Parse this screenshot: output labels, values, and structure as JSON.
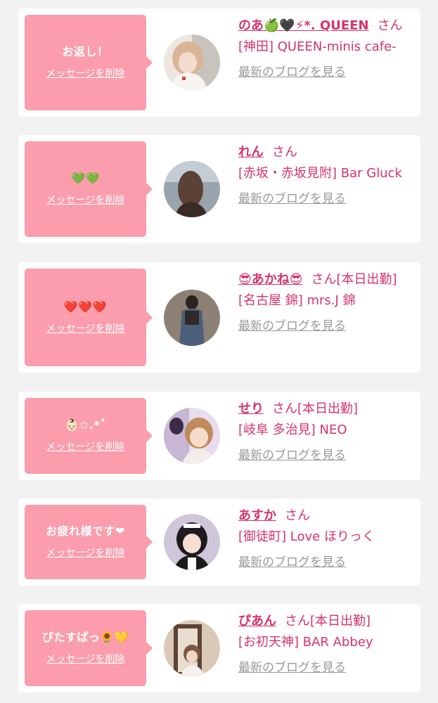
{
  "colors": {
    "page_bg": "#f2f2f2",
    "card_bg": "#ffffff",
    "bubble_bg": "#fb9dac",
    "accent": "#d6336c",
    "link_gray": "#999999"
  },
  "common": {
    "delete_label": "メッセージを削除",
    "blog_label": "最新のブログを見る",
    "san_label": "さん"
  },
  "cards": [
    {
      "message": "お返し！",
      "name": "のあ🍏🖤⚡*. QUEEN",
      "status": "",
      "shop": "[神田] QUEEN-minis cafe-",
      "avatar_icon": "profile-photo"
    },
    {
      "message": "💚💚",
      "name": "れん",
      "status": "",
      "shop": "[赤坂・赤坂見附] Bar Gluck",
      "avatar_icon": "profile-photo"
    },
    {
      "message": "❤️❤️❤️",
      "name": "😎あかね😎",
      "status": "[本日出勤]",
      "shop": "[名古屋 錦] mrs.J 錦",
      "avatar_icon": "profile-photo"
    },
    {
      "message": "👶🏻✩.*˚",
      "name": "せり",
      "status": "[本日出勤]",
      "shop": "[岐阜 多治見] NEO",
      "avatar_icon": "profile-photo"
    },
    {
      "message": "お疲れ様です❤",
      "name": "あすか",
      "status": "",
      "shop": "[御徒町] Love ほりっく",
      "avatar_icon": "profile-photo"
    },
    {
      "message": "ぴたすぱっ🌻💛",
      "name": "ぴあん",
      "status": "[本日出勤]",
      "shop": "[お初天神] BAR Abbey",
      "avatar_icon": "profile-photo"
    }
  ]
}
